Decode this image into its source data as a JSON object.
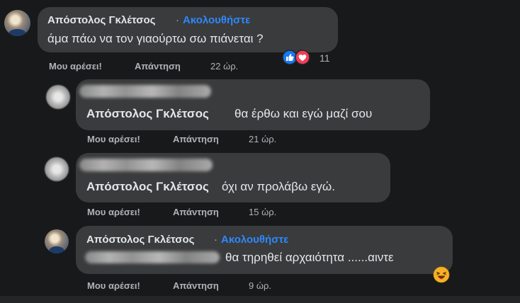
{
  "comments": [
    {
      "author": "Απόστολος Γκλέτσος",
      "separator": "·",
      "follow_label": "Ακολουθήστε",
      "text": "άμα πάω να τον γιαούρτω σω πιάνεται ?",
      "reaction_count": "11",
      "like_label": "Μου αρέσει!",
      "reply_label": "Απάντηση",
      "time": "22 ώρ."
    },
    {
      "mention": "Απόστολος Γκλέτσος",
      "text": "θα έρθω και εγώ μαζί σου",
      "like_label": "Μου αρέσει!",
      "reply_label": "Απάντηση",
      "time": "21 ώρ."
    },
    {
      "mention": "Απόστολος Γκλέτσος",
      "text": "όχι αν προλάβω εγώ.",
      "like_label": "Μου αρέσει!",
      "reply_label": "Απάντηση",
      "time": "15 ώρ."
    },
    {
      "author": "Απόστολος Γκλέτσος",
      "separator": "·",
      "follow_label": "Ακολουθήστε",
      "text": "θα τηρηθεί αρχαιότητα ......αιντε",
      "like_label": "Μου αρέσει!",
      "reply_label": "Απάντηση",
      "time": "9 ώρ."
    }
  ],
  "icons": {
    "like": "like-icon",
    "love": "love-icon",
    "laugh": "laughing-emoji-icon"
  },
  "colors": {
    "background": "#18191a",
    "bubble": "#3a3b3c",
    "text": "#e4e6eb",
    "secondary_text": "#b0b3b8",
    "link": "#2d88ff",
    "like_blue": "#1877f2",
    "love_red": "#f33e58"
  }
}
